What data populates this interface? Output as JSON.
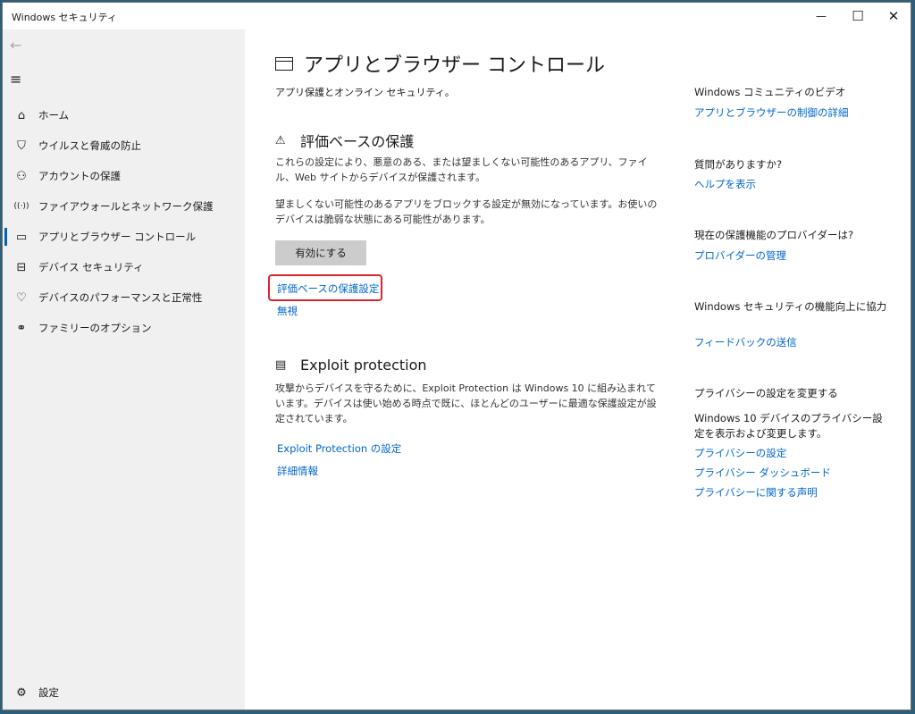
{
  "window": {
    "title": "Windows セキュリティ",
    "minimize_glyph": "—",
    "maximize_glyph": "☐",
    "close_glyph": "✕"
  },
  "sidebar": {
    "back_glyph": "←",
    "menu_glyph": "≡",
    "items": [
      {
        "label": "ホーム",
        "icon": "home-icon",
        "glyph": "⌂"
      },
      {
        "label": "ウイルスと脅威の防止",
        "icon": "shield-icon",
        "glyph": "⛉"
      },
      {
        "label": "アカウントの保護",
        "icon": "person-icon",
        "glyph": "⚇"
      },
      {
        "label": "ファイアウォールとネットワーク保護",
        "icon": "wifi-icon",
        "glyph": "((·))"
      },
      {
        "label": "アプリとブラウザー コントロール",
        "icon": "app-browser-icon",
        "glyph": "▭"
      },
      {
        "label": "デバイス セキュリティ",
        "icon": "laptop-icon",
        "glyph": "⊟"
      },
      {
        "label": "デバイスのパフォーマンスと正常性",
        "icon": "heart-icon",
        "glyph": "♡"
      },
      {
        "label": "ファミリーのオプション",
        "icon": "family-icon",
        "glyph": "⚭"
      }
    ],
    "settings": {
      "label": "設定",
      "icon": "gear-icon",
      "glyph": "⚙"
    }
  },
  "main": {
    "title": "アプリとブラウザー コントロール",
    "subtitle": "アプリ保護とオンライン セキュリティ。",
    "reputation": {
      "heading": "評価ベースの保護",
      "icon_glyph": "⚠",
      "desc1": "これらの設定により、悪意のある、または望ましくない可能性のあるアプリ、ファイル、Web サイトからデバイスが保護されます。",
      "desc2": "望ましくない可能性のあるアプリをブロックする設定が無効になっています。お使いのデバイスは脆弱な状態にある可能性があります。",
      "enable_button": "有効にする",
      "settings_link": "評価ベースの保護設定",
      "ignore_link": "無視"
    },
    "exploit": {
      "heading": "Exploit protection",
      "icon_glyph": "▤",
      "desc": "攻撃からデバイスを守るために、Exploit Protection は Windows 10 に組み込まれています。デバイスは使い始める時点で既に、ほとんどのユーザーに最適な保護設定が設定されています。",
      "settings_link": "Exploit Protection の設定",
      "info_link": "詳細情報"
    }
  },
  "right_panel": {
    "community": {
      "heading": "Windows コミュニティのビデオ",
      "link": "アプリとブラウザーの制御の詳細"
    },
    "questions": {
      "heading": "質問がありますか?",
      "link": "ヘルプを表示"
    },
    "provider": {
      "heading": "現在の保護機能のプロバイダーは?",
      "link": "プロバイダーの管理"
    },
    "improve": {
      "heading": "Windows セキュリティの機能向上に協力",
      "link": "フィードバックの送信"
    },
    "privacy": {
      "heading": "プライバシーの設定を変更する",
      "text": "Windows 10 デバイスのプライバシー設定を表示および変更します。",
      "links": [
        "プライバシーの設定",
        "プライバシー ダッシュボード",
        "プライバシーに関する声明"
      ]
    }
  },
  "colors": {
    "accent": "#0063b1",
    "link": "#0066cc",
    "highlight": "#d9262d",
    "sidebar_bg": "#f0f0f0"
  }
}
